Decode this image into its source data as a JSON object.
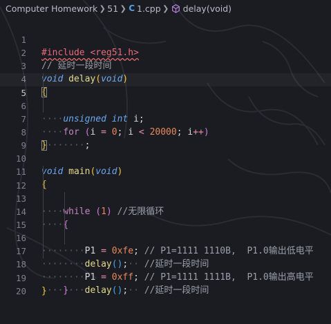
{
  "breadcrumb": {
    "folder": "Computer Homework",
    "subfolder": "51",
    "file_icon": "C",
    "file": "1.cpp",
    "symbol": "delay(void)"
  },
  "line_numbers": [
    "1",
    "2",
    "3",
    "4",
    "5",
    "6",
    "7",
    "8",
    "9",
    "10",
    "11",
    "12",
    "13",
    "14",
    "15",
    "16",
    "17",
    "18",
    "19",
    "20"
  ],
  "code": {
    "l1_include": "#include <reg51.h>",
    "l2_comment": "// 延时一段时间",
    "l3_void": "void",
    "l3_fn": "delay",
    "l3_param": "void",
    "l4_brace": "{",
    "l5_unsigned": "unsigned",
    "l5_int": "int",
    "l5_var": "i;",
    "l6_for": "for",
    "l6_open": "(",
    "l6_init_var": "i",
    "l6_eq": "=",
    "l6_zero": "0",
    "l6_semi1": ";",
    "l6_cond_var": "i",
    "l6_lt": "<",
    "l6_limit": "20000",
    "l6_semi2": ";",
    "l6_inc_var": "i",
    "l6_inc": "++",
    "l6_close": ")",
    "l7_semi": ";",
    "l8_brace": "}",
    "l10_void": "void",
    "l10_fn": "main",
    "l10_param": "void",
    "l11_brace": "{",
    "l12_while": "while",
    "l12_one": "1",
    "l12_comment": "//无限循环",
    "l13_brace": "{",
    "l14_port": "P1",
    "l14_eq": "=",
    "l14_val": "0xfe",
    "l14_semi": ";",
    "l14_comment": "// P1=1111 1110B,  P1.0输出低电平",
    "l15_fn": "delay",
    "l15_paren": "()",
    "l15_semi": ";",
    "l15_comment": "//延时一段时间",
    "l16_port": "P1",
    "l16_eq": "=",
    "l16_val": "0xff",
    "l16_semi": ";",
    "l16_comment": "// P1=1111 1111B,  P1.0输出高电平",
    "l17_fn": "delay",
    "l17_paren": "()",
    "l17_semi": ";",
    "l17_comment": "//延时一段时间",
    "l18_brace": "}",
    "l19_brace": "}"
  },
  "colors": {
    "background": "#1b1c22",
    "keyword": "#6aa7ee",
    "control": "#c586c0",
    "function": "#e5d98b",
    "number": "#e98a5a",
    "comment": "#9aa0a8",
    "bracket_level1": "#f0c53b",
    "bracket_level2": "#d37ad6",
    "bracket_level3": "#47a4f0"
  }
}
